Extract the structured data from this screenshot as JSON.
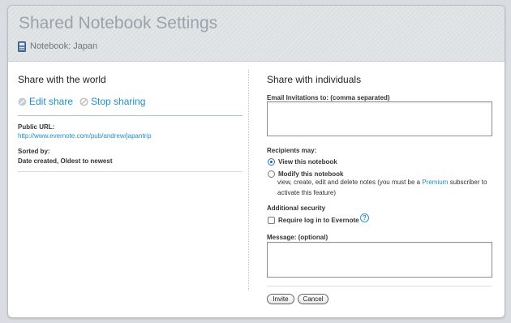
{
  "header": {
    "title": "Shared Notebook Settings",
    "notebook_label": "Notebook: Japan"
  },
  "left": {
    "heading": "Share with the world",
    "edit_share": "Edit share",
    "stop_sharing": "Stop sharing",
    "public_url_label": "Public URL:",
    "public_url": "http://www.evernote.com/pub/andrew/japantrip",
    "sorted_by_label": "Sorted by:",
    "sorted_by_value": "Date created, Oldest to newest"
  },
  "right": {
    "heading": "Share with individuals",
    "email_label": "Email Invitations to: (comma separated)",
    "email_value": "",
    "recipients_label": "Recipients may:",
    "option_view": "View this notebook",
    "option_modify": "Modify this notebook",
    "modify_desc_1": "view, create, edit and delete notes (you must be a",
    "modify_desc_premium": "Premium",
    "modify_desc_2": "subscriber to",
    "modify_desc_3": "activate this feature)",
    "security_label": "Additional security",
    "require_login": "Require log in to Evernote",
    "help_glyph": "?",
    "message_label": "Message: (optional)",
    "message_value": "",
    "invite_button": "Invite",
    "cancel_button": "Cancel"
  },
  "state": {
    "selected_permission": "View this notebook",
    "require_login_checked": false
  },
  "colors": {
    "link": "#1e8fc6",
    "title": "#9aa3aa"
  },
  "icons": {
    "notebook": "notebook-icon",
    "edit": "pencil-icon",
    "stop": "stop-icon",
    "help": "help-icon"
  }
}
